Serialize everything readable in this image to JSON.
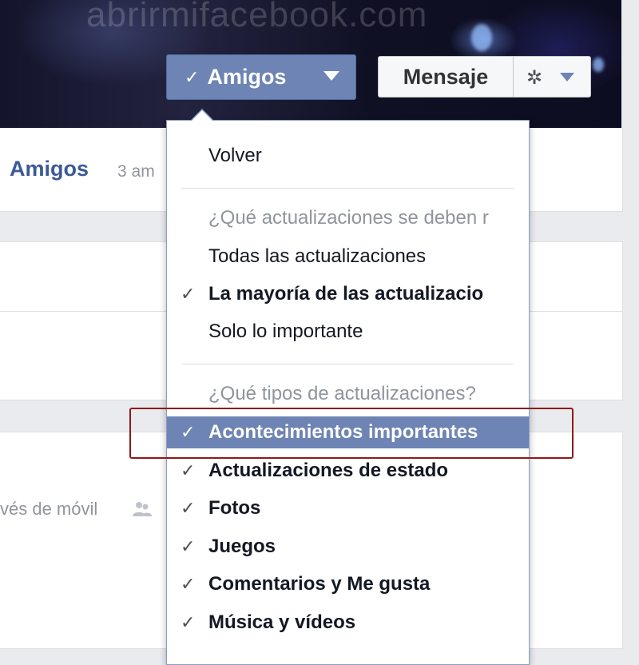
{
  "watermark": "abrirmifacebook.com",
  "cover_buttons": {
    "friends_check_icon": "checkmark-icon",
    "friends_label": "Amigos",
    "message_label": "Mensaje",
    "settings_icon": "gear-icon"
  },
  "profile": {
    "friends_link": "Amigos",
    "friends_count_partial": "3 am",
    "mobile_text_partial": "vés de móvil"
  },
  "menu": {
    "back": "Volver",
    "updates_question": "¿Qué actualizaciones se deben r",
    "updates_options": [
      {
        "label": "Todas las actualizaciones",
        "checked": false
      },
      {
        "label": "La mayoría de las actualizacio",
        "checked": true
      },
      {
        "label": "Solo lo importante",
        "checked": false
      }
    ],
    "types_question": "¿Qué tipos de actualizaciones?",
    "type_options": [
      {
        "label": "Acontecimientos importantes",
        "checked": true,
        "highlighted": true
      },
      {
        "label": "Actualizaciones de estado",
        "checked": true
      },
      {
        "label": "Fotos",
        "checked": true
      },
      {
        "label": "Juegos",
        "checked": true
      },
      {
        "label": "Comentarios y Me gusta",
        "checked": true
      },
      {
        "label": "Música y vídeos",
        "checked": true
      }
    ],
    "check_glyph": "✓"
  },
  "colors": {
    "accent": "#6d84b4",
    "link": "#3b5998",
    "annotation_border": "#8e1a1a"
  }
}
